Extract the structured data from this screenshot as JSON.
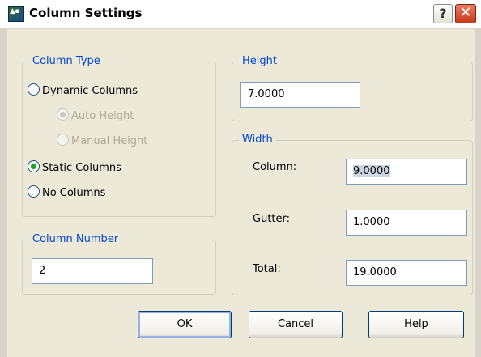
{
  "window": {
    "title": "Column Settings",
    "help_button": "?",
    "close_button": "✕",
    "icon_text": "▲▪"
  },
  "column_type": {
    "legend": "Column Type",
    "options": [
      {
        "label": "Dynamic Columns",
        "checked": false,
        "enabled": true
      },
      {
        "label": "Auto Height",
        "checked": true,
        "enabled": false
      },
      {
        "label": "Manual Height",
        "checked": false,
        "enabled": false
      },
      {
        "label": "Static Columns",
        "checked": true,
        "enabled": true
      },
      {
        "label": "No Columns",
        "checked": false,
        "enabled": true
      }
    ]
  },
  "column_number": {
    "legend": "Column Number",
    "value": "2"
  },
  "height": {
    "legend": "Height",
    "value": "7.0000"
  },
  "width": {
    "legend": "Width",
    "column_label": "Column:",
    "column_value": "9.0000",
    "gutter_label": "Gutter:",
    "gutter_value": "1.0000",
    "total_label": "Total:",
    "total_value": "19.0000"
  },
  "buttons": {
    "ok": "OK",
    "cancel": "Cancel",
    "help": "Help"
  },
  "colors": {
    "legend_text": "#0046d5",
    "dialog_face": "#ece9d8",
    "radio_check": "#21a121"
  }
}
